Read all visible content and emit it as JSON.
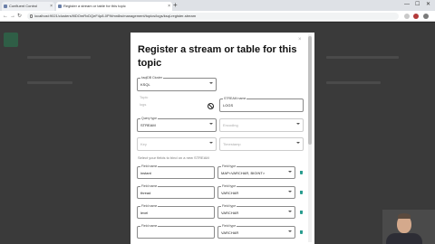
{
  "browser": {
    "tabs": [
      {
        "label": "Confluent Control"
      },
      {
        "label": "Register a stream or table for this topic"
      }
    ],
    "url": "localhost:9021/clusters/9lDOmRxDQeF4p8-0PWmn8w/management/topics/logs/ksql-register-stream",
    "new_tab": "+",
    "window_controls": {
      "min": "—",
      "max": "☐",
      "close": "✕"
    }
  },
  "modal": {
    "close": "×",
    "title": "Register a stream or table for this topic",
    "ksqldb_cluster": {
      "label": "ksqlDB Cluster",
      "value": "KSQL"
    },
    "topics": {
      "label": "Topic",
      "value": "logs"
    },
    "stream_name": {
      "label": "STREAM name",
      "value": "LOGS"
    },
    "query_type": {
      "label": "Query type",
      "value": "STREAM"
    },
    "encoding": {
      "label": "",
      "placeholder": "Encoding"
    },
    "key": {
      "label": "",
      "placeholder": "Key"
    },
    "timestamp": {
      "label": "",
      "placeholder": "Timestamp"
    },
    "section_label": "Select your fields to bind on a new STREAM",
    "fields": [
      {
        "name_label": "Field name",
        "name": "instant",
        "type_label": "Field type",
        "type": "MAP<VARCHAR, BIGINT>"
      },
      {
        "name_label": "Field name",
        "name": "thread",
        "type_label": "Field type",
        "type": "VARCHAR"
      },
      {
        "name_label": "Field name",
        "name": "level",
        "type_label": "Field type",
        "type": "VARCHAR"
      },
      {
        "name_label": "Field name",
        "name": "",
        "type_label": "Field type",
        "type": "VARCHAR"
      }
    ]
  },
  "colors": {
    "accent": "#2a9d8f",
    "modal_bg": "#ffffff",
    "page_bg": "#3a3a3a"
  }
}
